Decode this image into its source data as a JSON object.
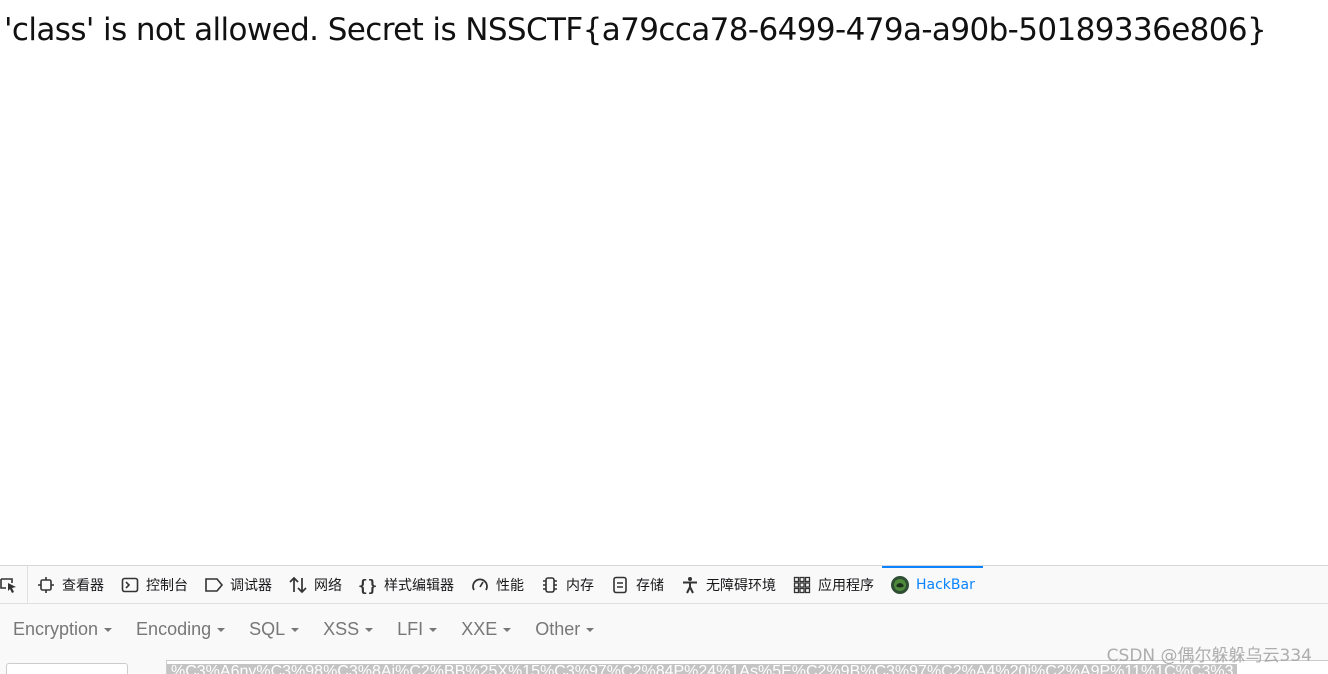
{
  "page": {
    "message": "'class' is not allowed. Secret is NSSCTF{a79cca78-6499-479a-a90b-50189336e806}"
  },
  "devtools": {
    "picker_icon": "element-picker-icon",
    "tabs": [
      {
        "label": "查看器",
        "icon": "inspector-icon"
      },
      {
        "label": "控制台",
        "icon": "console-icon"
      },
      {
        "label": "调试器",
        "icon": "debugger-icon"
      },
      {
        "label": "网络",
        "icon": "network-icon"
      },
      {
        "label": "样式编辑器",
        "icon": "style-editor-icon"
      },
      {
        "label": "性能",
        "icon": "performance-icon"
      },
      {
        "label": "内存",
        "icon": "memory-icon"
      },
      {
        "label": "存储",
        "icon": "storage-icon"
      },
      {
        "label": "无障碍环境",
        "icon": "accessibility-icon"
      },
      {
        "label": "应用程序",
        "icon": "application-icon"
      },
      {
        "label": "HackBar",
        "icon": "hackbar-icon",
        "selected": true
      }
    ],
    "accent_color": "#0a84ff"
  },
  "hackbar": {
    "menu": [
      "Encryption",
      "Encoding",
      "SQL",
      "XSS",
      "LFI",
      "XXE",
      "Other"
    ],
    "url_value": "%C3%A6ny%C3%98%C3%8Aj%C2%BB%25X%15%C3%97%C2%84P%24%1As%5E%C2%9B%C3%97%C2%A4%20j%C2%A9P%11%1C%C3%3"
  },
  "watermark": "CSDN @偶尔躲躲乌云334"
}
